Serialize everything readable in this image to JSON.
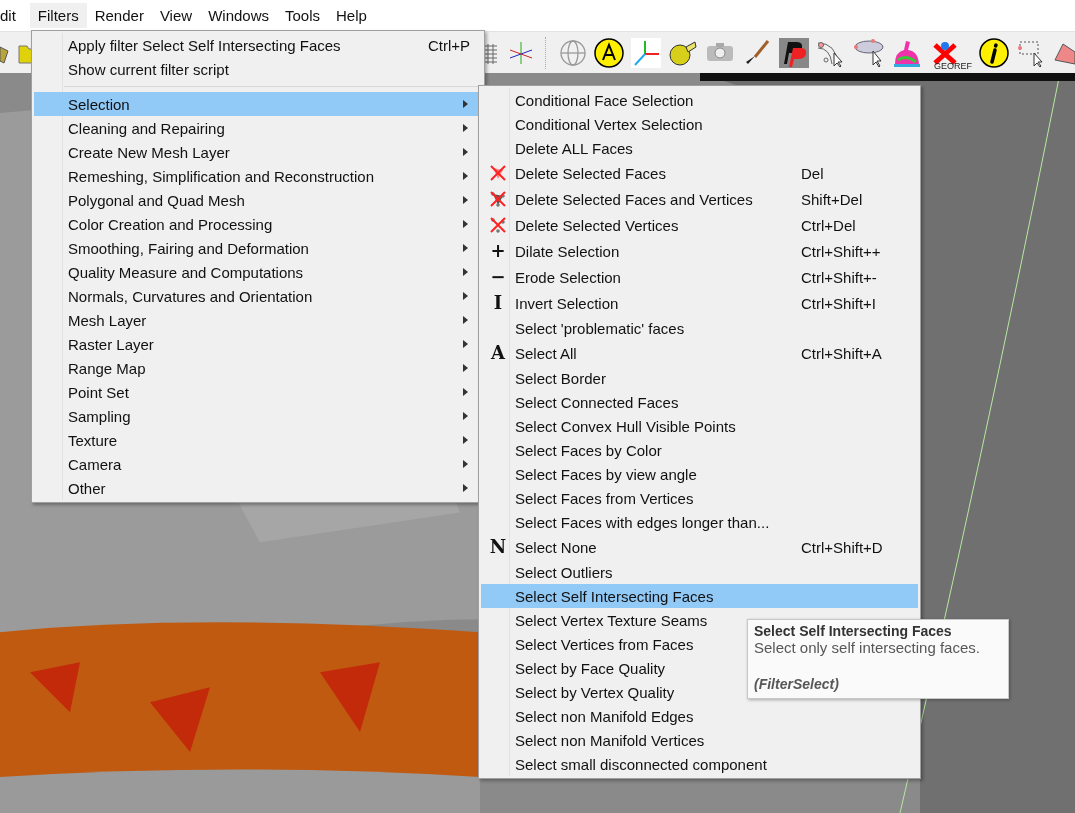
{
  "menubar": [
    {
      "label": "dit",
      "selected": false
    },
    {
      "label": "Filters",
      "selected": true
    },
    {
      "label": "Render",
      "selected": false
    },
    {
      "label": "View",
      "selected": false
    },
    {
      "label": "Windows",
      "selected": false
    },
    {
      "label": "Tools",
      "selected": false
    },
    {
      "label": "Help",
      "selected": false
    }
  ],
  "toolbar": {
    "georef_label": "GEOREF"
  },
  "filters_menu": {
    "actions": [
      {
        "label": "Apply filter Select Self Intersecting Faces",
        "shortcut": "Ctrl+P"
      },
      {
        "label": "Show current filter script"
      }
    ],
    "categories": [
      {
        "label": "Selection",
        "selected": true
      },
      {
        "label": "Cleaning and Repairing",
        "selected": false
      },
      {
        "label": "Create New Mesh Layer",
        "selected": false
      },
      {
        "label": "Remeshing, Simplification and Reconstruction",
        "selected": false
      },
      {
        "label": "Polygonal and Quad Mesh",
        "selected": false
      },
      {
        "label": "Color Creation and Processing",
        "selected": false
      },
      {
        "label": "Smoothing, Fairing and Deformation",
        "selected": false
      },
      {
        "label": "Quality Measure and Computations",
        "selected": false
      },
      {
        "label": "Normals, Curvatures and Orientation",
        "selected": false
      },
      {
        "label": "Mesh Layer",
        "selected": false
      },
      {
        "label": "Raster Layer",
        "selected": false
      },
      {
        "label": "Range Map",
        "selected": false
      },
      {
        "label": "Point Set",
        "selected": false
      },
      {
        "label": "Sampling",
        "selected": false
      },
      {
        "label": "Texture",
        "selected": false
      },
      {
        "label": "Camera",
        "selected": false
      },
      {
        "label": "Other",
        "selected": false
      }
    ]
  },
  "selection_submenu": [
    {
      "kind": "plain",
      "label": "Conditional Face Selection",
      "selected": false
    },
    {
      "kind": "plain",
      "label": "Conditional Vertex Selection",
      "selected": false
    },
    {
      "kind": "plain",
      "label": "Delete ALL Faces",
      "selected": false
    },
    {
      "kind": "delete-faces",
      "label": "Delete Selected Faces",
      "shortcut": "Del",
      "selected": false
    },
    {
      "kind": "delete-both",
      "label": "Delete Selected Faces and Vertices",
      "shortcut": "Shift+Del",
      "selected": false
    },
    {
      "kind": "delete-vertices",
      "label": "Delete Selected Vertices",
      "shortcut": "Ctrl+Del",
      "selected": false
    },
    {
      "kind": "glyph",
      "glyph": "+",
      "label": "Dilate Selection",
      "shortcut": "Ctrl+Shift++",
      "selected": false
    },
    {
      "kind": "glyph",
      "glyph": "−",
      "label": "Erode Selection",
      "shortcut": "Ctrl+Shift+-",
      "selected": false
    },
    {
      "kind": "glyph",
      "glyph": "I",
      "label": "Invert Selection",
      "shortcut": "Ctrl+Shift+I",
      "selected": false
    },
    {
      "kind": "plain",
      "label": "Select 'problematic' faces",
      "selected": false
    },
    {
      "kind": "glyph",
      "glyph": "A",
      "label": "Select All",
      "shortcut": "Ctrl+Shift+A",
      "selected": false
    },
    {
      "kind": "plain",
      "label": "Select Border",
      "selected": false
    },
    {
      "kind": "plain",
      "label": "Select Connected Faces",
      "selected": false
    },
    {
      "kind": "plain",
      "label": "Select Convex Hull Visible Points",
      "selected": false
    },
    {
      "kind": "plain",
      "label": "Select Faces by Color",
      "selected": false
    },
    {
      "kind": "plain",
      "label": "Select Faces by view angle",
      "selected": false
    },
    {
      "kind": "plain",
      "label": "Select Faces from Vertices",
      "selected": false
    },
    {
      "kind": "plain",
      "label": "Select Faces with edges longer than...",
      "selected": false
    },
    {
      "kind": "glyph",
      "glyph": "N",
      "label": "Select None",
      "shortcut": "Ctrl+Shift+D",
      "selected": false
    },
    {
      "kind": "plain",
      "label": "Select Outliers",
      "selected": false
    },
    {
      "kind": "plain",
      "label": "Select Self Intersecting Faces",
      "selected": true
    },
    {
      "kind": "plain",
      "label": "Select Vertex Texture Seams",
      "selected": false
    },
    {
      "kind": "plain",
      "label": "Select Vertices from Faces",
      "selected": false
    },
    {
      "kind": "plain",
      "label": "Select by Face Quality",
      "selected": false
    },
    {
      "kind": "plain",
      "label": "Select by Vertex Quality",
      "selected": false
    },
    {
      "kind": "plain",
      "label": "Select non Manifold Edges",
      "selected": false
    },
    {
      "kind": "plain",
      "label": "Select non Manifold Vertices",
      "selected": false
    },
    {
      "kind": "plain",
      "label": "Select small disconnected component",
      "selected": false
    }
  ],
  "tooltip": {
    "title": "Select Self Intersecting Faces",
    "description": "Select only self intersecting faces.",
    "filter_name": "(FilterSelect)"
  }
}
